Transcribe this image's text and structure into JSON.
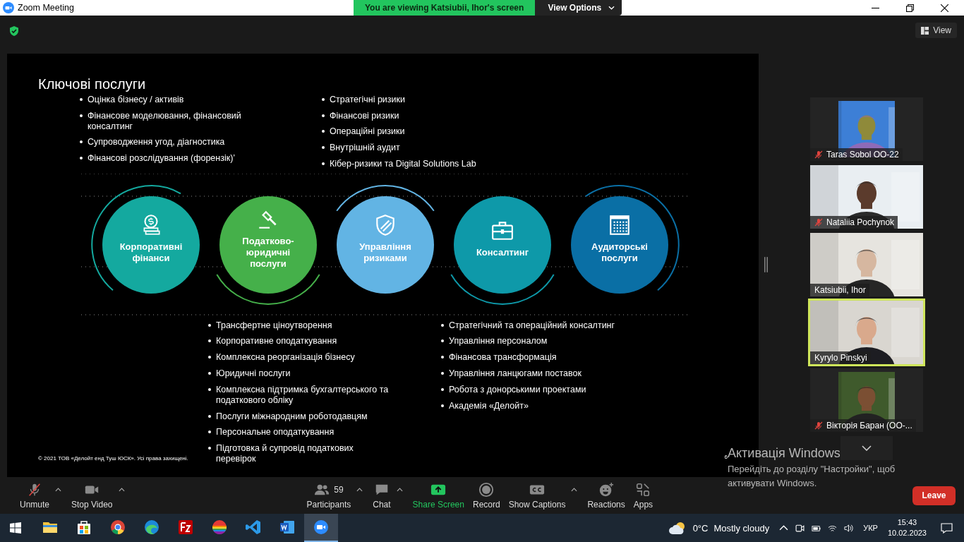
{
  "window": {
    "title": "Zoom Meeting"
  },
  "share_banner": {
    "text": "You are viewing Katsiubii, Ihor's screen",
    "button": "View Options"
  },
  "view_button": "View",
  "slide": {
    "title": "Ключові послуги",
    "top_columns": [
      [
        "Оцінка бізнесу / активів",
        "Фінансове моделювання, фінансовий консалтинг",
        "Супроводження угод, діагностика",
        "Фінансові розслідування (форензік)’"
      ],
      [
        "Стратегічні ризики",
        "Фінансові ризики",
        "Операційні ризики",
        "Внутрішній аудит",
        "Кібер-ризики та Digital Solutions Lab"
      ]
    ],
    "services": [
      {
        "label": "Корпоративні фінанси",
        "color": "#14a99f"
      },
      {
        "label": "Податково-юридичні послуги",
        "color": "#45b04a"
      },
      {
        "label": "Управління ризиками",
        "color": "#62b4e4"
      },
      {
        "label": "Консалтинг",
        "color": "#0e99a9"
      },
      {
        "label": "Аудиторські послуги",
        "color": "#0a6fa5"
      }
    ],
    "bottom_columns": [
      [
        "Трансфертне ціноутворення",
        "Корпоративне оподаткування",
        "Комплексна реорганізація бізнесу",
        "Юридичні послуги",
        "Комплексна підтримка бухгалтерського та податкового обліку",
        "Послуги міжнародним роботодавцям",
        "Персональне оподаткування",
        "Підготовка й супровід податкових перевірок"
      ],
      [
        "Стратегічний та операційний консалтинг",
        "Управління персоналом",
        "Фінансова трансформація",
        "Управління ланцюгами поставок",
        "Робота з донорськими проектами",
        "Академія «Делойт»"
      ]
    ],
    "footer": "© 2021 ТОВ «Делойт енд Туш ЮСК». Усі права захищені.",
    "page": "6"
  },
  "participants": [
    {
      "name": "Taras Sobol OO-22",
      "muted": true,
      "speaking": false
    },
    {
      "name": "Nataliia Pochynok",
      "muted": true,
      "speaking": false
    },
    {
      "name": "Katsiubii, Ihor",
      "muted": false,
      "speaking": false
    },
    {
      "name": "Kyrylo Pinskyi",
      "muted": false,
      "speaking": true
    },
    {
      "name": "Вікторія Баран (ОО-...",
      "muted": true,
      "speaking": false
    }
  ],
  "toolbar": [
    {
      "label": "Unmute",
      "kind": "mic-off",
      "menu": true
    },
    {
      "label": "Stop Video",
      "kind": "camera",
      "menu": true
    },
    {
      "label": "Participants",
      "kind": "people",
      "count": "59",
      "menu": true
    },
    {
      "label": "Chat",
      "kind": "chat",
      "menu": true
    },
    {
      "label": "Share Screen",
      "kind": "share",
      "menu": false
    },
    {
      "label": "Record",
      "kind": "record",
      "menu": false
    },
    {
      "label": "Show Captions",
      "kind": "cc",
      "menu": true
    },
    {
      "label": "Reactions",
      "kind": "reactions",
      "menu": false
    },
    {
      "label": "Apps",
      "kind": "apps",
      "menu": false
    }
  ],
  "leave_button": "Leave",
  "activation": {
    "title": "Активація Windows",
    "text": "Перейдіть до розділу \"Настройки\", щоб активувати Windows."
  },
  "taskbar": {
    "apps": [
      {
        "kind": "folder",
        "selected": false
      },
      {
        "kind": "store",
        "selected": false
      },
      {
        "kind": "chrome",
        "selected": false
      },
      {
        "kind": "edge",
        "selected": false
      },
      {
        "kind": "filezilla",
        "selected": false
      },
      {
        "kind": "rainbow",
        "selected": false
      },
      {
        "kind": "vscode",
        "selected": false
      },
      {
        "kind": "word",
        "selected": false
      },
      {
        "kind": "zoom",
        "selected": true
      }
    ],
    "weather": {
      "temp": "0°C",
      "text": "Mostly cloudy"
    },
    "language": "УКР",
    "time": "15:43",
    "date": "10.02.2023"
  }
}
